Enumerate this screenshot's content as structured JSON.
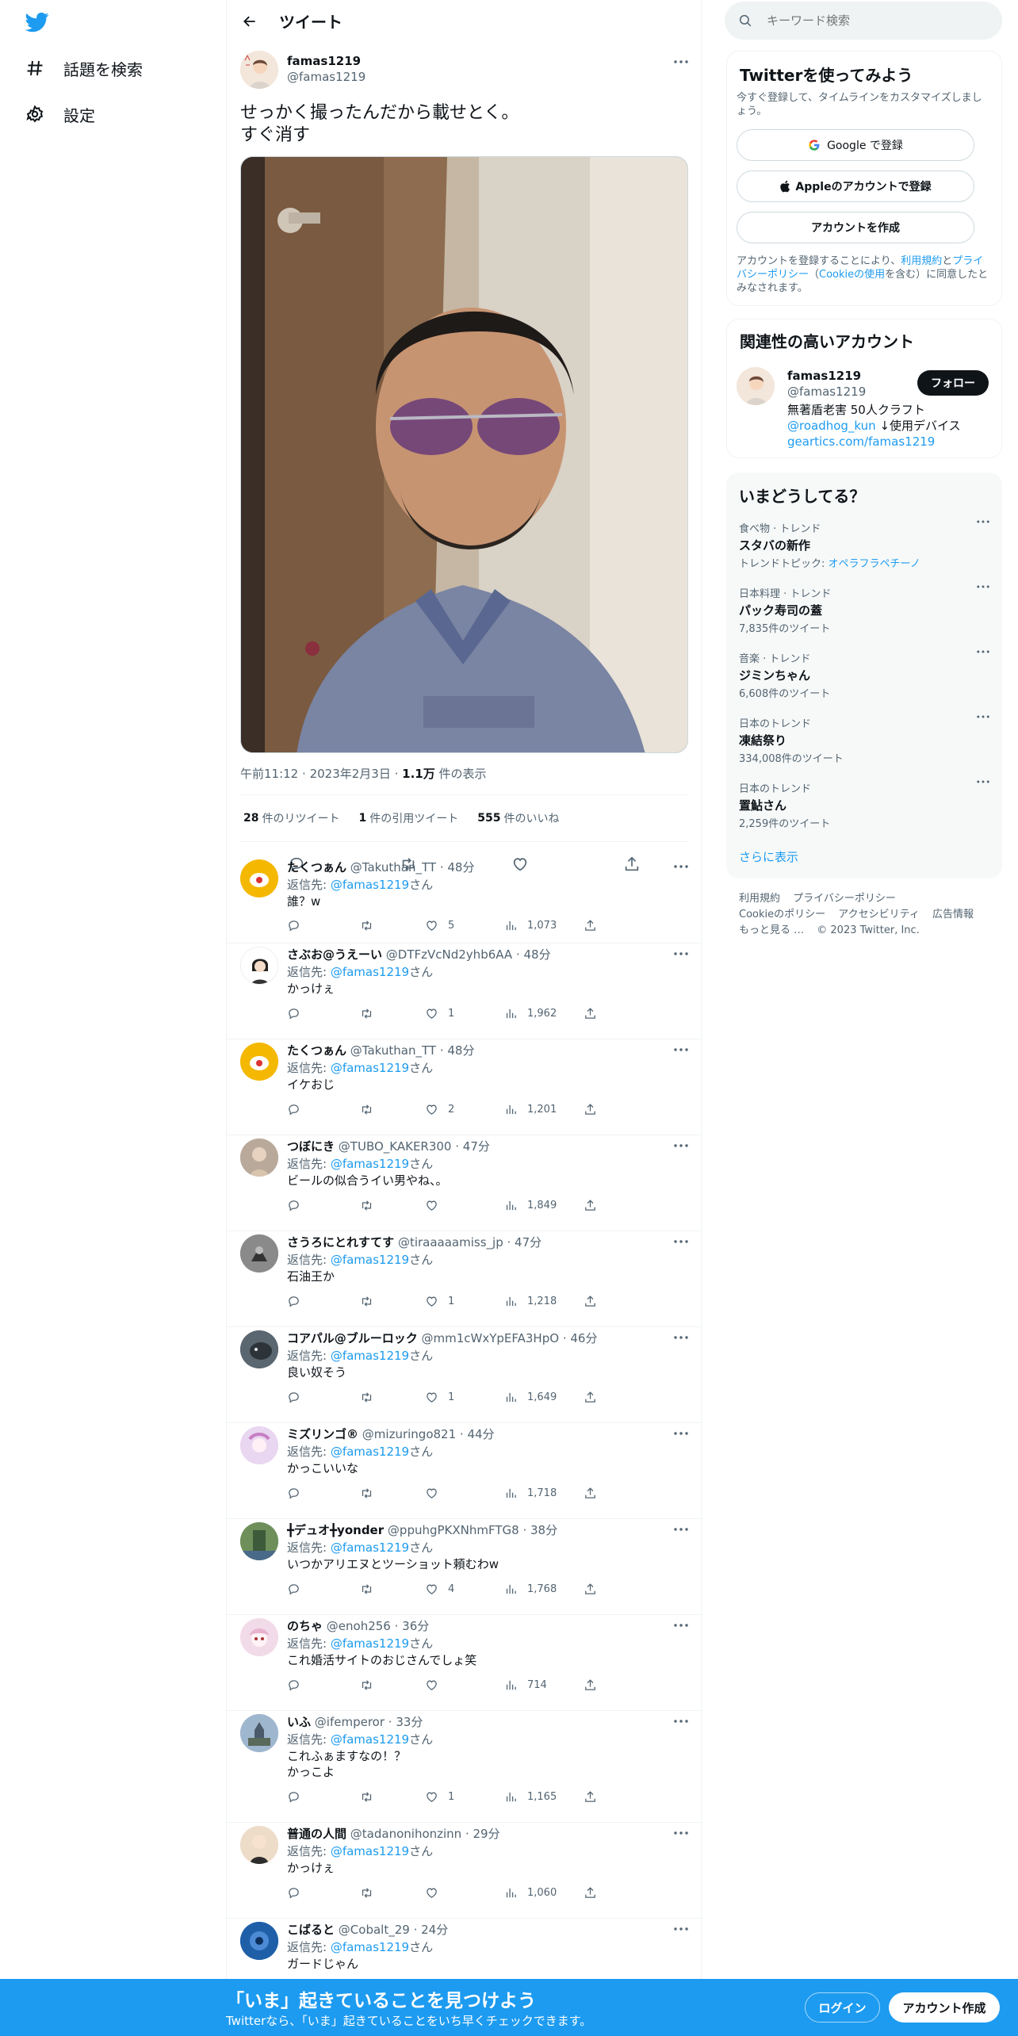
{
  "nav": {
    "explore_label": "話題を検索",
    "settings_label": "設定"
  },
  "header": {
    "title": "ツイート"
  },
  "tweet": {
    "name": "famas1219",
    "handle": "@famas1219",
    "text": "せっかく撮ったんだから載せとく。\nすぐ消す",
    "time": "午前11:12",
    "date": "2023年2月3日",
    "views_count": "1.1万",
    "views_label": " 件の表示",
    "retweets_count": "28",
    "retweets_label": "件のリツイート",
    "quotes_count": "1",
    "quotes_label": "件の引用ツイート",
    "likes_count": "555",
    "likes_label": "件のいいね"
  },
  "replying_to_prefix": "返信先: ",
  "replying_to_handle": "@famas1219",
  "replying_to_suffix": "さん",
  "replies": [
    {
      "name": "たくつぁん",
      "handle": "@Takuthan_TT",
      "time": "48分",
      "text": "誰？w",
      "likes": "5",
      "views": "1,073",
      "avatar_color": "#f5b800"
    },
    {
      "name": "さぶお@うえーい",
      "handle": "@DTFzVcNd2yhb6AA",
      "time": "48分",
      "text": "かっけぇ",
      "likes": "1",
      "views": "1,962",
      "avatar_color": "#ffffff"
    },
    {
      "name": "たくつぁん",
      "handle": "@Takuthan_TT",
      "time": "48分",
      "text": "イケおじ",
      "likes": "2",
      "views": "1,201",
      "avatar_color": "#f5b800"
    },
    {
      "name": "つぼにき",
      "handle": "@TUBO_KAKER300",
      "time": "47分",
      "text": "ビールの似合うイい男やね、。",
      "likes": "",
      "views": "1,849",
      "avatar_color": "#b9a99a"
    },
    {
      "name": "さうろにとれすてす",
      "handle": "@tiraaaaamiss_jp",
      "time": "47分",
      "text": "石油王か",
      "likes": "1",
      "views": "1,218",
      "avatar_color": "#8a8a8a"
    },
    {
      "name": "コアパル@ブルーロック",
      "handle": "@mm1cWxYpEFA3HpO",
      "time": "46分",
      "text": "良い奴そう",
      "likes": "1",
      "views": "1,649",
      "avatar_color": "#5a6670"
    },
    {
      "name": "ミズリンゴ®",
      "handle": "@mizuringo821",
      "time": "44分",
      "text": "かっこいいな",
      "likes": "",
      "views": "1,718",
      "avatar_color": "#e9d6f0"
    },
    {
      "name": "╋デュオ╋yonder",
      "handle": "@ppuhgPKXNhmFTG8",
      "time": "38分",
      "text": "いつかアリエヌとツーショット頼むわw",
      "likes": "4",
      "views": "1,768",
      "avatar_color": "#6e8f5a"
    },
    {
      "name": "のちゃ",
      "handle": "@enoh256",
      "time": "36分",
      "text": "これ婚活サイトのおじさんでしょ笑",
      "likes": "",
      "views": "714",
      "avatar_color": "#f2dbe8"
    },
    {
      "name": "いふ",
      "handle": "@ifemperor",
      "time": "33分",
      "text": "これふぁますなの！？\nかっこよ",
      "likes": "1",
      "views": "1,165",
      "avatar_color": "#9fb6cf"
    },
    {
      "name": "普通の人間",
      "handle": "@tadanonihonzinn",
      "time": "29分",
      "text": "かっけぇ",
      "likes": "",
      "views": "1,060",
      "avatar_color": "#eddcc8"
    },
    {
      "name": "こばると",
      "handle": "@Cobalt_29",
      "time": "24分",
      "text": "ガードじゃん",
      "likes": "",
      "views": "",
      "avatar_color": "#1f5fa8"
    }
  ],
  "search": {
    "placeholder": "キーワード検索"
  },
  "signup_card": {
    "title": "Twitterを使ってみよう",
    "subtitle": "今すぐ登録して、タイムラインをカスタマイズしましょう。",
    "google_label": "Google で登録",
    "apple_label": "Appleのアカウントで登録",
    "create_label": "アカウントを作成",
    "terms_pre": "アカウントを登録することにより、",
    "terms_link": "利用規約",
    "terms_and": "と",
    "privacy_link": "プライバシーポリシー",
    "cookie_open": "（",
    "cookie_link": "Cookieの使用",
    "terms_post": "を含む）に同意したとみなされます。"
  },
  "related_card": {
    "title": "関連性の高いアカウント",
    "name": "famas1219",
    "handle": "@famas1219",
    "follow_label": "フォロー",
    "bio_line1": "無著盾老害 50人クラフト",
    "bio_mention": "@roadhog_kun",
    "bio_after_mention": " ↓使用デバイス",
    "bio_link": "geartics.com/famas1219"
  },
  "trends_card": {
    "title": "いまどうしてる？",
    "items": [
      {
        "category": "食べ物 · トレンド",
        "name": "スタバの新作",
        "count": "トレンドトピック: ",
        "topic": "オペラフラペチーノ"
      },
      {
        "category": "日本料理 · トレンド",
        "name": "パック寿司の蓋",
        "count": "7,835件のツイート",
        "topic": ""
      },
      {
        "category": "音楽 · トレンド",
        "name": "ジミンちゃん",
        "count": "6,608件のツイート",
        "topic": ""
      },
      {
        "category": "日本のトレンド",
        "name": "凍結祭り",
        "count": "334,008件のツイート",
        "topic": ""
      },
      {
        "category": "日本のトレンド",
        "name": "置鮎さん",
        "count": "2,259件のツイート",
        "topic": ""
      }
    ],
    "show_more": "さらに表示"
  },
  "footer": {
    "terms": "利用規約",
    "privacy": "プライバシーポリシー",
    "cookie": "Cookieのポリシー",
    "accessibility": "アクセシビリティ",
    "ads": "広告情報",
    "more": "もっと見る …",
    "copyright": "© 2023 Twitter, Inc."
  },
  "bottom_bar": {
    "title": "「いま」起きていることを見つけよう",
    "subtitle": "Twitterなら、「いま」起きていることをいち早くチェックできます。",
    "login_label": "ログイン",
    "signup_label": "アカウント作成"
  },
  "colors": {
    "accent": "#1d9bf0",
    "text": "#0f1419",
    "muted": "#536471"
  }
}
